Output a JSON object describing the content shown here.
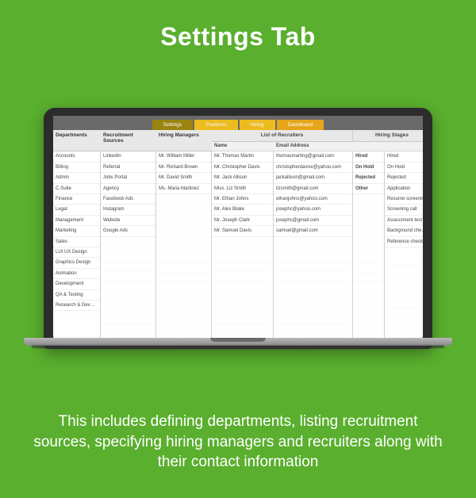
{
  "title": "Settings Tab",
  "caption": "This includes defining departments, listing recruitment sources, specifying hiring managers and recruiters along with their contact information",
  "tabs": {
    "settings": "Settings",
    "positions": "Positions",
    "hiring": "Hiring",
    "dashboard": "Dashboard"
  },
  "headers": {
    "departments": "Departments",
    "recruitment_sources": "Recruitment Sources",
    "hiring_managers": "Hiring Managers",
    "list_of_recruiters": "List of Recruiters",
    "hiring_stages": "Hiring Stages",
    "name": "Name",
    "email": "Email Address"
  },
  "departments": [
    "Accounts",
    "Billing",
    "Admin",
    "C-Suite",
    "Finance",
    "Legal",
    "Management",
    "Marketing",
    "Sales",
    "LUI UX Design",
    "Graphics Design",
    "Animation",
    "Development",
    "QA & Testing",
    "Research & Development"
  ],
  "sources": [
    "LinkedIn",
    "Referral",
    "Jobs Portal",
    "Agency",
    "Facebook Ads",
    "Instagram",
    "Website",
    "Google Ads"
  ],
  "managers": [
    "Mr. William Miller",
    "Mr. Richard Brown",
    "Mr. David Smith",
    "Ms. Maria Martinez"
  ],
  "recruiters": [
    {
      "name": "Mr. Thomas Martin",
      "email": "thomasmarting@gmail.com"
    },
    {
      "name": "Mr. Christopher Davis",
      "email": "christopherdavisv@yahoo.com"
    },
    {
      "name": "Mr. Jack Allison",
      "email": "jackallison@gmail.com"
    },
    {
      "name": "Miss. Liz Smith",
      "email": "lizsmith@gmail.com"
    },
    {
      "name": "Mr. Ethan Johns",
      "email": "ethanjohns@yahoo.com"
    },
    {
      "name": "Mr. Alex Blake",
      "email": "josephc@yahoo.com"
    },
    {
      "name": "Mr. Joseph Clark",
      "email": "josephc@gmail.com"
    },
    {
      "name": "Mr. Samuel Davis",
      "email": "samuel@gmail.com"
    }
  ],
  "stage_labels": [
    "Hired",
    "On Hold",
    "Rejected",
    "Other"
  ],
  "stages": [
    "Hired",
    "On Hold",
    "Rejected",
    "Application",
    "Resume screening",
    "Screening call",
    "Assessment test",
    "Background checks",
    "Reference checks"
  ]
}
